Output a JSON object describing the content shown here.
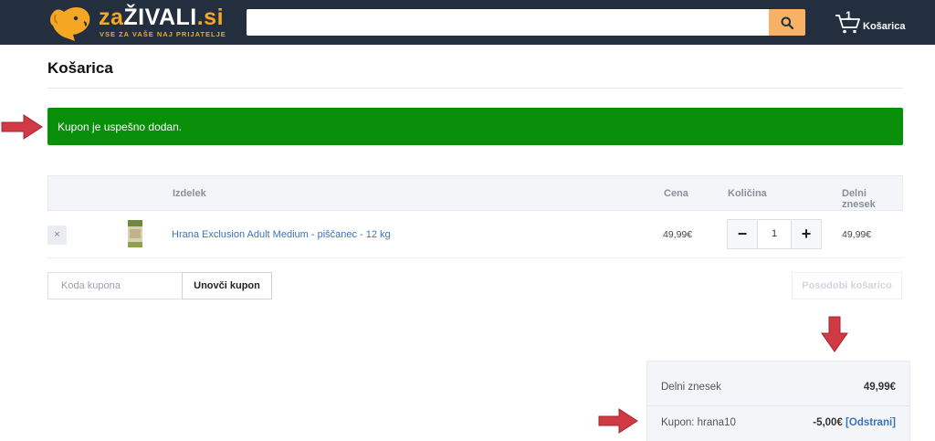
{
  "header": {
    "logo_prefix": "za",
    "logo_middle": "ŽIVALI",
    "logo_suffix": ".si",
    "logo_tagline": "VSE ZA VAŠE NAJ PRIJATELJE",
    "search_value": "",
    "cart_count": "1",
    "cart_label": "Košarica",
    "icons": {
      "logo": "dog-icon",
      "search": "search-icon",
      "cart": "cart-icon"
    },
    "colors": {
      "bar": "#232f3e",
      "accent": "#f5a623",
      "search_button": "#f7b267"
    }
  },
  "page": {
    "title": "Košarica",
    "notice": "Kupon je uspešno dodan.",
    "notice_color": "#0a8f0a"
  },
  "cart_table": {
    "headers": {
      "product": "Izdelek",
      "price": "Cena",
      "quantity": "Količina",
      "subtotal": "Delni znesek"
    },
    "rows": [
      {
        "remove": "×",
        "product": "Hrana Exclusion Adult Medium - piščanec - 12 kg",
        "price": "49,99€",
        "qty_minus": "−",
        "quantity": "1",
        "qty_plus": "+",
        "subtotal": "49,99€"
      }
    ]
  },
  "coupon": {
    "placeholder": "Koda kupona",
    "apply_label": "Unovči kupon",
    "update_label": "Posodobi košarico"
  },
  "totals": {
    "subtotal_label": "Delni znesek",
    "subtotal_value": "49,99€",
    "coupon_label": "Kupon: hrana10",
    "coupon_value": "-5,00€",
    "coupon_remove": "[Odstrani]"
  }
}
